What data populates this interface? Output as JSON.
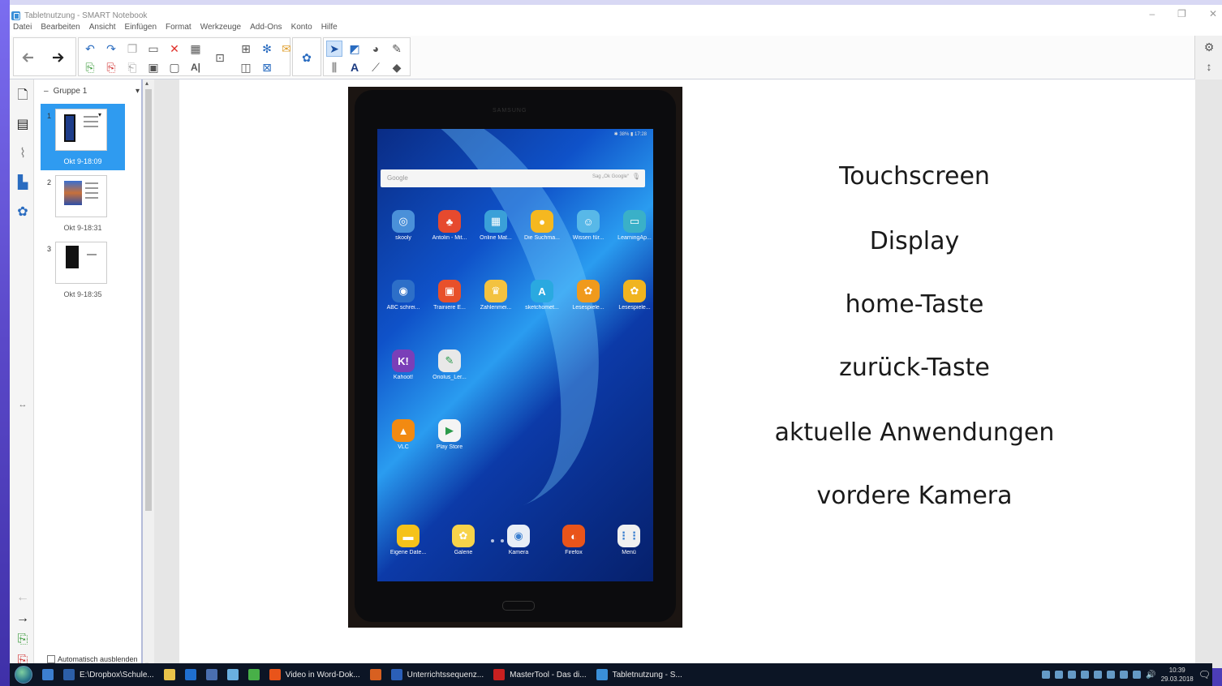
{
  "window": {
    "title": "Tabletnutzung - SMART Notebook",
    "controls": [
      "–",
      "❐",
      "✕"
    ]
  },
  "menu": [
    "Datei",
    "Bearbeiten",
    "Ansicht",
    "Einfügen",
    "Format",
    "Werkzeuge",
    "Add-Ons",
    "Konto",
    "Hilfe"
  ],
  "sorter": {
    "group_label": "Gruppe 1",
    "pages": [
      {
        "num": "1",
        "date": "Okt 9-18:09"
      },
      {
        "num": "2",
        "date": "Okt 9-18:31"
      },
      {
        "num": "3",
        "date": "Okt 9-18:35"
      }
    ],
    "auto_hide_label": "Automatisch ausblenden"
  },
  "tablet": {
    "brand": "SAMSUNG",
    "status_right": "✱ 38% ▮ 17:28",
    "search_placeholder": "Google",
    "search_hint": "Sag „Ok Google“",
    "apps": [
      {
        "label": "skooly",
        "color": "#4a90d9",
        "glyph": "◎"
      },
      {
        "label": "Antolin - Mit...",
        "color": "#e64a2e",
        "glyph": "♣"
      },
      {
        "label": "Online Mat...",
        "color": "#3aa0d8",
        "glyph": "▦"
      },
      {
        "label": "Die Suchma...",
        "color": "#f5b820",
        "glyph": "●"
      },
      {
        "label": "Wissen für...",
        "color": "#58b8e8",
        "glyph": "☺"
      },
      {
        "label": "LearningAp...",
        "color": "#3ab0c8",
        "glyph": "▭"
      },
      {
        "label": "ABC schrei...",
        "color": "#2d6fc8",
        "glyph": "◉"
      },
      {
        "label": "Trainiere E...",
        "color": "#e8502a",
        "glyph": "▣"
      },
      {
        "label": "Zahlenmei...",
        "color": "#f3c240",
        "glyph": "♛"
      },
      {
        "label": "sketchomet...",
        "color": "#2aa9e0",
        "glyph": "A"
      },
      {
        "label": "Lesespiele...",
        "color": "#f09a1c",
        "glyph": "✿"
      },
      {
        "label": "Lesespiele...",
        "color": "#f0b420",
        "glyph": "✿"
      },
      {
        "label": "Kahoot!",
        "color": "#7a3fb8",
        "glyph": "K!"
      },
      {
        "label": "Oriolus_Ler...",
        "color": "#e8e8e8",
        "glyph": "✎"
      },
      {
        "label": "VLC",
        "color": "#f28a12",
        "glyph": "▲"
      },
      {
        "label": "Play Store",
        "color": "#f4f4f4",
        "glyph": "▶"
      }
    ],
    "dock": [
      {
        "label": "Eigene Date...",
        "color": "#f5c21a",
        "glyph": "▬"
      },
      {
        "label": "Galerie",
        "color": "#f7d34a",
        "glyph": "✿"
      },
      {
        "label": "Kamera",
        "color": "#e8eef6",
        "glyph": "◉"
      },
      {
        "label": "Firefox",
        "color": "#e9541a",
        "glyph": "◐"
      },
      {
        "label": "Menü",
        "color": "#f0f0f0",
        "glyph": "⋮⋮"
      }
    ]
  },
  "terms": [
    "Touchscreen",
    "Display",
    "home-Taste",
    "zurück-Taste",
    "aktuelle Anwendungen",
    "vordere Kamera"
  ],
  "taskbar": {
    "items": [
      {
        "label": "",
        "color": "#3c7fd0"
      },
      {
        "label": "E:\\Dropbox\\Schule...",
        "color": "#2c5fa8"
      },
      {
        "label": "",
        "color": "#e8c24a"
      },
      {
        "label": "",
        "color": "#1f6fd0"
      },
      {
        "label": "",
        "color": "#4a6fb0"
      },
      {
        "label": "",
        "color": "#6ab0e0"
      },
      {
        "label": "",
        "color": "#48b048"
      },
      {
        "label": "Video in Word-Dok...",
        "color": "#e9541a"
      },
      {
        "label": "",
        "color": "#d86020"
      },
      {
        "label": "Unterrichtssequenz...",
        "color": "#2b5fb8"
      },
      {
        "label": "MasterTool - Das di...",
        "color": "#c82020"
      },
      {
        "label": "Tabletnutzung - S...",
        "color": "#3a8fd8"
      }
    ],
    "time": "10:39",
    "date": "29.03.2018"
  }
}
